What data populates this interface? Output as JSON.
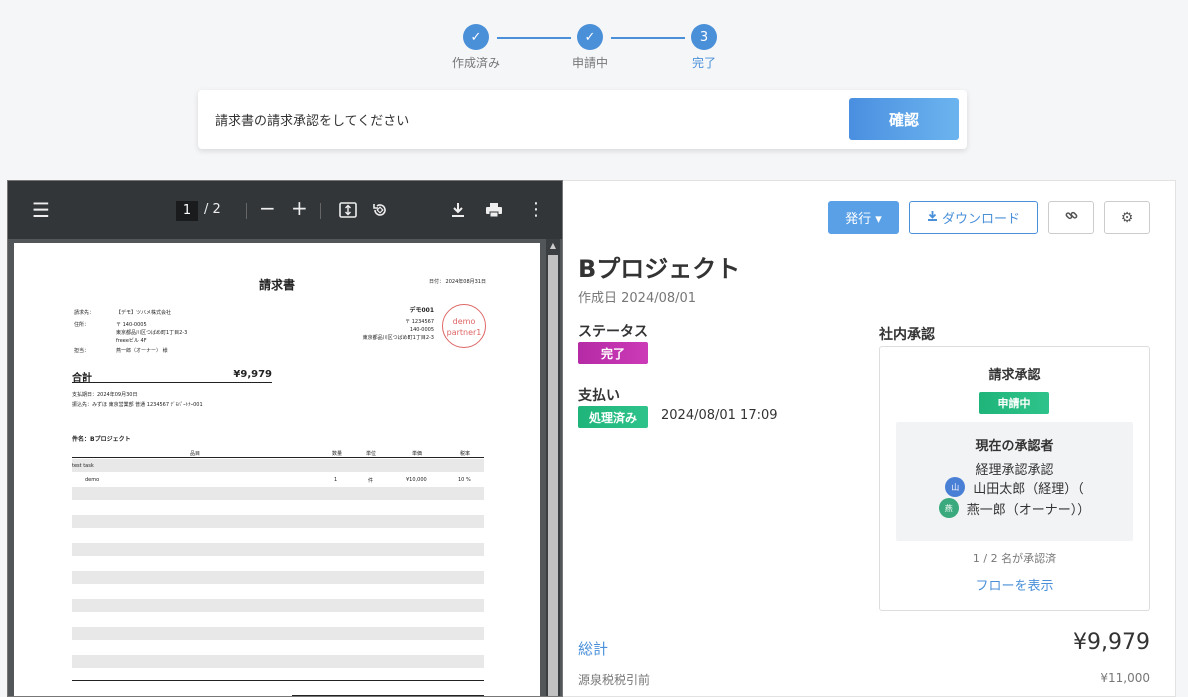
{
  "stepper": {
    "steps": [
      {
        "icon": "check-icon",
        "label": "作成済み"
      },
      {
        "icon": "check-icon",
        "label": "申請中"
      },
      {
        "number": "3",
        "label": "完了"
      }
    ],
    "color": "#4a90d9"
  },
  "banner": {
    "message": "請求書の請求承認をしてください",
    "confirm_label": "確認"
  },
  "pdf_viewer": {
    "current_page": "1",
    "page_total": "/ 2",
    "document": {
      "title": "請求書",
      "date": "日付： 2024年08月31日",
      "to_label": "請求先：",
      "to_value": "【デモ】ツバメ株式会社",
      "addr_label": "住所：",
      "addr_lines": [
        "〒 140-0005",
        "東京都品川区つばめ町1丁目2-3",
        "freeeビル 4F"
      ],
      "person_label": "担当：",
      "person_value": "燕一郎（オーナー） 様",
      "issuer_name": "デモ001",
      "issuer_lines": [
        "〒 1234567",
        "140-0005",
        "東京都品川区つばめ町1丁目2-3"
      ],
      "stamp_lines": [
        "demo",
        "partner1"
      ],
      "total_label": "合計",
      "total_value": "¥9,979",
      "due_date": "支払期日：2024年09月30日",
      "bank": "振込先：みずほ 東京営業部 普通 1234567 ﾃﾞﾓﾊﾟｰﾄﾅｰ001",
      "subject": "件名：Bプロジェクト",
      "columns": [
        "品目",
        "数量",
        "単位",
        "単価",
        "税率"
      ],
      "rows": [
        {
          "name": "test task",
          "qty": "",
          "unit": "",
          "price": "",
          "tax": ""
        },
        {
          "name": "demo",
          "qty": "1",
          "unit": "件",
          "price": "¥10,000",
          "tax": "10 %"
        }
      ]
    }
  },
  "panel": {
    "buttons": {
      "issue": "発行 ▾",
      "download": "ダウンロード",
      "link_icon": "link-icon",
      "gear_icon": "gear-icon"
    },
    "title": "Bプロジェクト",
    "created": "作成日 2024/08/01",
    "status_label": "ステータス",
    "status_value": "完了",
    "payment_label": "支払い",
    "payment_status": "処理済み",
    "payment_date": "2024/08/01 17:09",
    "approval": {
      "section_label": "社内承認",
      "title": "請求承認",
      "status": "申請中",
      "current_title": "現在の承認者",
      "group": "経理承認承認",
      "approvers": [
        {
          "avatar": "山",
          "name": "山田太郎（経理）（",
          "color": "#4a7fd6"
        },
        {
          "avatar": "燕",
          "name": "燕一郎（オーナー））",
          "color": "#3aaa7e"
        }
      ],
      "count": "1 / 2 名が承認済",
      "flow_link": "フローを表示"
    },
    "total_label": "総計",
    "total_value": "¥9,979",
    "pre_tax_label": "源泉税税引前",
    "pre_tax_value": "¥11,000"
  }
}
